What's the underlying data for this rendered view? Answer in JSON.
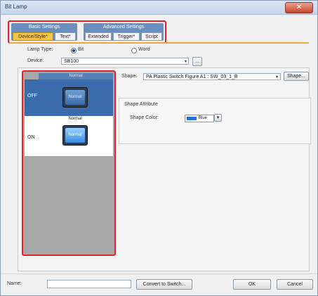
{
  "window": {
    "title": "Bit Lamp",
    "close_glyph": "✕"
  },
  "tabs": {
    "basic_group": "Basic Settings",
    "advanced_group": "Advanced Settings",
    "items": [
      "Device/Style*",
      "Text*",
      "Extended",
      "Trigger*",
      "Script"
    ]
  },
  "form": {
    "lamp_type_label": "Lamp Type:",
    "lamp_type_options": [
      "Bit",
      "Word"
    ],
    "lamp_type_selected": "Bit",
    "device_label": "Device:",
    "device_value": "SB100",
    "browse_label": "..."
  },
  "states": {
    "column_header": "Normal",
    "rows": [
      {
        "label": "OFF",
        "state_name": "Normal",
        "lamp_text": "Normal"
      },
      {
        "label": "ON",
        "state_name": "Normal",
        "lamp_text": "Normal"
      }
    ]
  },
  "shape": {
    "label": "Shape:",
    "value": "PA Plastic Switch Figure A1 : SW_03_1_B",
    "button": "Shape..."
  },
  "shape_attribute": {
    "title": "Shape Attribute",
    "color_label": "Shape Color:",
    "color_value": "Blue",
    "color_hex": "#2a6fd6"
  },
  "footer": {
    "name_label": "Name:",
    "name_value": "",
    "convert_button": "Convert to Switch...",
    "ok_button": "OK",
    "cancel_button": "Cancel"
  }
}
